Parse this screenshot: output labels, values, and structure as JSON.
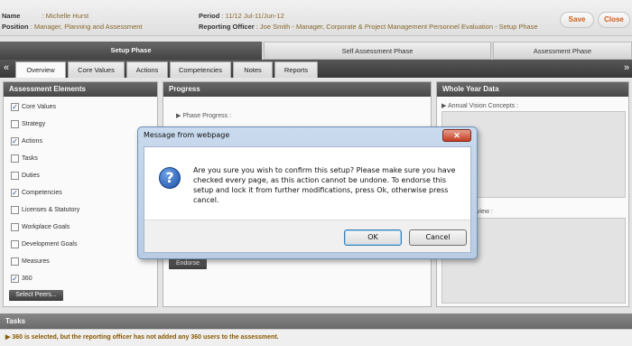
{
  "header": {
    "name_label": "Name",
    "name_value": ": Michelle Hurst",
    "position_label": "Position",
    "position_value": ": Manager, Planning and Assessment",
    "period_label": "Period",
    "period_value": ": 11/12 Jul-11/Jun-12",
    "reporting_label": "Reporting Officer",
    "reporting_value": ": Joe Smith - Manager, Corporate & Project Management Personnel Evaluation - Setup Phase",
    "save_label": "Save",
    "close_label": "Close"
  },
  "phases": [
    "Setup Phase",
    "Self Assessment Phase",
    "Assessment Phase"
  ],
  "tabs": {
    "left_arrow": "«",
    "right_arrow": "»",
    "items": [
      "Overview",
      "Core Values",
      "Actions",
      "Competencies",
      "Notes",
      "Reports"
    ]
  },
  "assessment": {
    "title": "Assessment Elements",
    "items": [
      {
        "label": "Core Values",
        "checked": true
      },
      {
        "label": "Strategy",
        "checked": false
      },
      {
        "label": "Actions",
        "checked": true
      },
      {
        "label": "Tasks",
        "checked": false
      },
      {
        "label": "Duties",
        "checked": false
      },
      {
        "label": "Competencies",
        "checked": true
      },
      {
        "label": "Licenses & Statutory",
        "checked": false
      },
      {
        "label": "Workplace Goals",
        "checked": false
      },
      {
        "label": "Development Goals",
        "checked": false
      },
      {
        "label": "Measures",
        "checked": false
      },
      {
        "label": "360",
        "checked": true
      }
    ],
    "select_peers_label": "Select Peers..."
  },
  "progress": {
    "title": "Progress",
    "phase_progress_label": "▶ Phase Progress :",
    "endorse_label": "Endorse"
  },
  "whole_year": {
    "title": "Whole Year Data",
    "vision_label": "▶ Annual Vision Concepts :",
    "review_label": "eview :"
  },
  "tasks": {
    "title": "Tasks",
    "note": "▶ 360 is selected, but the reporting officer has not added any 360 users to the assessment."
  },
  "dialog": {
    "title": "Message from webpage",
    "close_glyph": "✕",
    "icon_glyph": "?",
    "message": "Are you sure you wish to confirm this setup? Please make sure you have checked every page, as this action cannot be undone. To endorse this setup and lock it from further modifications, press Ok, otherwise press cancel.",
    "ok_label": "OK",
    "cancel_label": "Cancel"
  }
}
